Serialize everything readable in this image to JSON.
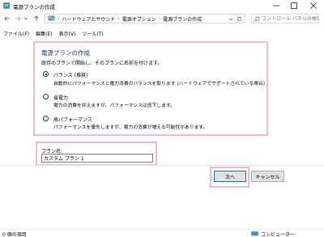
{
  "window": {
    "title": "電源プランの作成",
    "icon": "power-options-icon",
    "controls": [
      "minimize-icon",
      "maximize-icon",
      "close-icon"
    ]
  },
  "navigation": {
    "breadcrumb": [
      "ハードウェアとサウンド",
      "電源オプション",
      "電源プランの作成"
    ],
    "breadcrumb_separator": "›",
    "search_placeholder": "コントロール パネルの検索"
  },
  "menu": {
    "items": [
      "ファイル(F)",
      "編集(E)",
      "表示(V)",
      "ツール(T)"
    ]
  },
  "main": {
    "heading": "電源プランの作成",
    "instructions": "既存のプランで開始し、そのプランに名前を付けます。",
    "options": [
      {
        "title": "バランス (推奨)",
        "description": "自動的にパフォーマンスと電力消費のバランスを取ります (ハードウェアでサポートされている場合)",
        "selected": true
      },
      {
        "title": "省電力",
        "description": "電力の消費を抑えますが、パフォーマンスは低下します。",
        "selected": false
      },
      {
        "title": "高パフォーマンス",
        "description": "パフォーマンスを優先しますが、電力の消費が増える可能性があります。",
        "selected": false
      }
    ],
    "plan_name_label": "プラン名:",
    "plan_name_value": "カスタム プラン 1"
  },
  "buttons": {
    "next": "次へ",
    "cancel": "キャンセル"
  },
  "status": {
    "items_count": "0 個の項目",
    "location": "コンピューター"
  },
  "colors": {
    "heading": "#1e3287",
    "highlight": "#f0b8cd",
    "default_button_border": "#0078d7"
  }
}
